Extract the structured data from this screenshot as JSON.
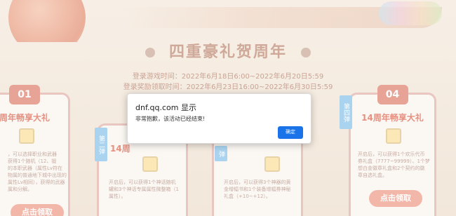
{
  "page": {
    "title": "四重豪礼贺周年",
    "time_line1": "登录游戏时间：2022年6月18日6:00~2022年6月20日5:59",
    "time_line2": "登录奖励领取时间：2022年6月23日16:00~2022年6月30日5:59"
  },
  "cards": [
    {
      "num": "01",
      "heading": "周年畅享大礼",
      "desc": "，可以选择职业和武器\n获得1个随机（12、锻\n的本职武器（属性Lv符在\n物属的普通地下城中出现的\n属性Lv相同），获得的武器\n属和分解。",
      "button": "点击领取"
    },
    {
      "num": "",
      "heading": "14周",
      "desc": "开启后，可以获得1个神话随机\n罐和3个神话专属属性微整箱（1\n属性）。",
      "button": ""
    },
    {
      "num": "",
      "heading": "",
      "desc": "开启后，可以获得3个神器的黄\n金增幅书和1个装备增幅券神秘\n礼盒（+10~+12）。",
      "button": ""
    },
    {
      "num": "04",
      "heading": "14周年畅享大礼",
      "desc": "开启后，可以获得1个欢乐代币\n券礼盒（7777~99999）、1个梦\n想白金徽章礼盒和2个契约的徽\n章自选礼盒。",
      "button": "点击领取"
    }
  ],
  "tags": {
    "tag2": "第二弹",
    "tag3": "弹",
    "tag4": "第四弹"
  },
  "dialog": {
    "origin": "dnf.qq.com 显示",
    "message": "非常抱歉，该活动已经结束!",
    "ok_label": "确定"
  }
}
